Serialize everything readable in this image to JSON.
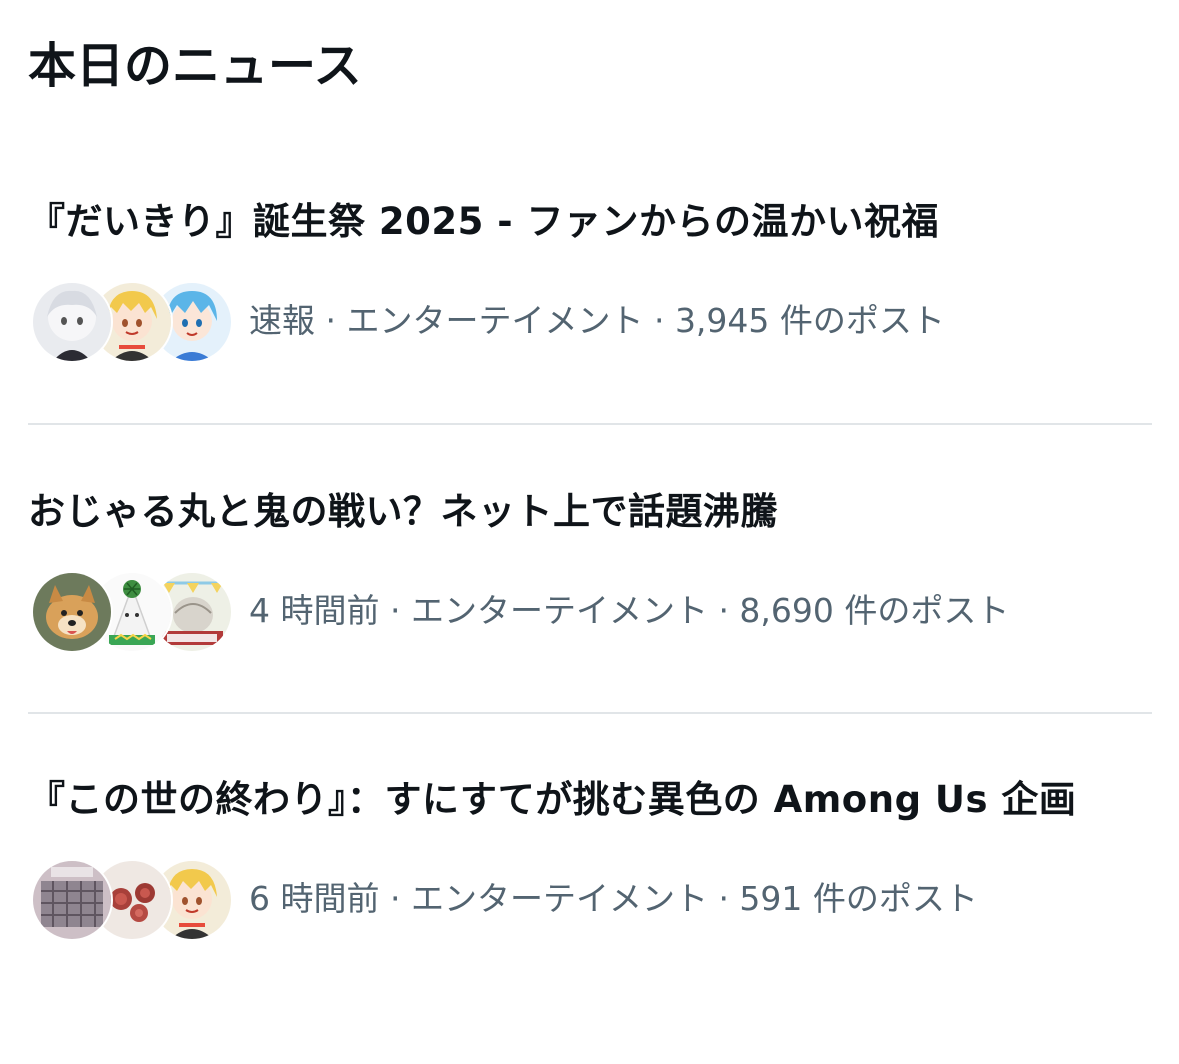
{
  "section": {
    "title": "本日のニュース"
  },
  "news": [
    {
      "headline": "『だいきり』誕生祭 2025 - ファンからの温かい祝福",
      "meta": "速報 · エンターテイメント · 3,945 件のポスト",
      "avatars": [
        "white-haired-anime-character-avatar",
        "blonde-anime-character-avatar",
        "blue-haired-anime-character-avatar"
      ]
    },
    {
      "headline": "おじゃる丸と鬼の戦い？ネット上で話題沸騰",
      "meta": "4 時間前 · エンターテイメント · 8,690 件のポスト",
      "avatars": [
        "dog-photo-avatar",
        "watermelon-character-avatar",
        "illustration-avatar"
      ]
    },
    {
      "headline": "『この世の終わり』：すにすてが挑む異色の Among Us 企画",
      "meta": "6 時間前 · エンターテイメント · 591 件のポスト",
      "avatars": [
        "plaid-clothing-photo-avatar",
        "roses-photo-avatar",
        "blonde-anime-character-avatar"
      ]
    }
  ],
  "colors": {
    "text": "#0f1419",
    "secondary": "#536471",
    "divider": "#e1e5e8",
    "background": "#ffffff"
  }
}
